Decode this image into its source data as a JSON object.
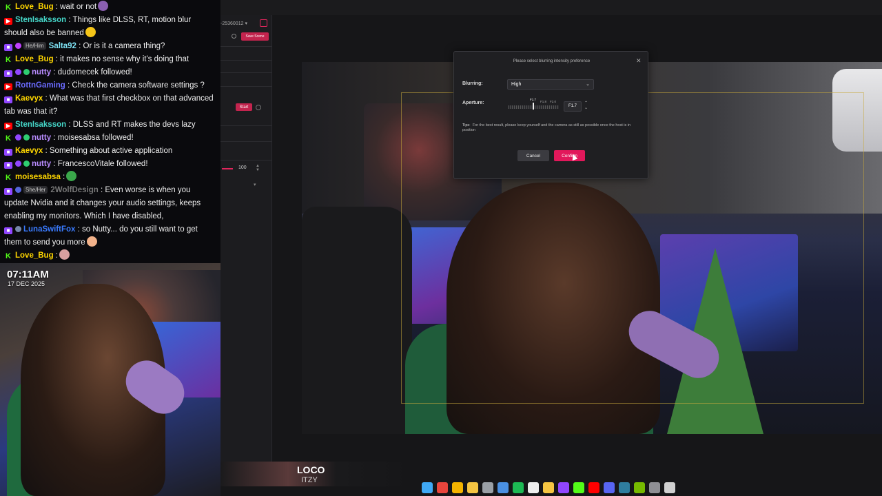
{
  "app": {
    "scene_id": "-25360012",
    "save_scene_label": "Save Scene",
    "start_label": "Start",
    "slider_value": "100"
  },
  "dialog": {
    "title": "Please select blurring intensity preference",
    "blurring_label": "Blurring:",
    "blurring_value": "High",
    "aperture_label": "Aperture:",
    "aperture_ticks": [
      "F1.7",
      "F1.8",
      "F2.0"
    ],
    "aperture_value": "F1.7",
    "tips_label": "Tipsː",
    "tips_text": "For the best result, please keep yourself and the camera as still as possible once the host is in position",
    "cancel_label": "Cancel",
    "confirm_label": "Confirm",
    "accent_color": "#e2185b"
  },
  "chat": {
    "messages": [
      {
        "platform": "kick",
        "user": "Love_Bug",
        "user_color": "#ffd700",
        "text": ": wait or not",
        "emote": "hat"
      },
      {
        "platform": "youtube",
        "user": "StenIsaksson",
        "user_color": "#45d6c8",
        "text": ": Things like DLSS, RT, motion blur should also be banned",
        "emote": "slight-smile"
      },
      {
        "platform": "twitch",
        "badges": [
          "gem",
          "He/Him"
        ],
        "user": "Salta92",
        "user_color": "#7fe3f5",
        "text": ": Or is it a camera thing?"
      },
      {
        "platform": "kick",
        "user": "Love_Bug",
        "user_color": "#ffd700",
        "text": ": it makes no sense why it's doing that"
      },
      {
        "platform": "twitch",
        "badges": [
          "mic",
          "verified"
        ],
        "user": "nutty",
        "user_color": "#b98cff",
        "text": ": dudomecek followed!"
      },
      {
        "platform": "youtube",
        "user": "RottnGaming",
        "user_color": "#6b6bff",
        "text": ": Check the camera software settings ?"
      },
      {
        "platform": "twitch",
        "user": "Kaevyx",
        "user_color": "#ffd700",
        "text": ": What was that first checkbox on that advanced tab was that it?"
      },
      {
        "platform": "youtube",
        "user": "StenIsaksson",
        "user_color": "#45d6c8",
        "text": ": DLSS and RT makes the devs lazy"
      },
      {
        "platform": "kick",
        "badges": [
          "mic",
          "verified"
        ],
        "user": "nutty",
        "user_color": "#b98cff",
        "text": ": moisesabsa followed!"
      },
      {
        "platform": "twitch",
        "user": "Kaevyx",
        "user_color": "#ffd700",
        "text": ": Something about active application"
      },
      {
        "platform": "twitch",
        "badges": [
          "mic",
          "verified"
        ],
        "user": "nutty",
        "user_color": "#b98cff",
        "text": ": FrancescoVitale followed!"
      },
      {
        "platform": "kick",
        "user": "moisesabsa",
        "user_color": "#ffd700",
        "text": ":",
        "emote": "alien"
      },
      {
        "platform": "twitch",
        "badges": [
          "grid",
          "She/Her"
        ],
        "user": "2WolfDesign",
        "user_color": "#777777",
        "text": ": Even worse is when you update Nvidia and it changes your audio settings, keeps enabling my monitors. Which I have disabled,"
      },
      {
        "platform": "twitch",
        "badges": [
          "robot"
        ],
        "user": "LunaSwiftFox",
        "user_color": "#3a7bff",
        "text": ": so Nutty... do you still want to get them to send you more",
        "emote": "peach"
      },
      {
        "platform": "kick",
        "user": "Love_Bug",
        "user_color": "#ffd700",
        "text": ":",
        "emote": "cat"
      }
    ]
  },
  "webcam": {
    "time": "07:11AM",
    "date": "17 DEC 2025"
  },
  "now_playing": {
    "title": "LOCO",
    "artist": "ITZY"
  },
  "taskbar": {
    "icons": [
      "windows-icon",
      "chrome-icon",
      "chrome-icon",
      "file-explorer-icon",
      "settings-icon",
      "app-icon",
      "spotify-icon",
      "document-icon",
      "notes-icon",
      "twitch-icon",
      "kick-icon",
      "youtube-icon",
      "discord-icon",
      "terminal-icon",
      "nvidia-icon",
      "camera-app-icon",
      "hand-icon"
    ]
  }
}
